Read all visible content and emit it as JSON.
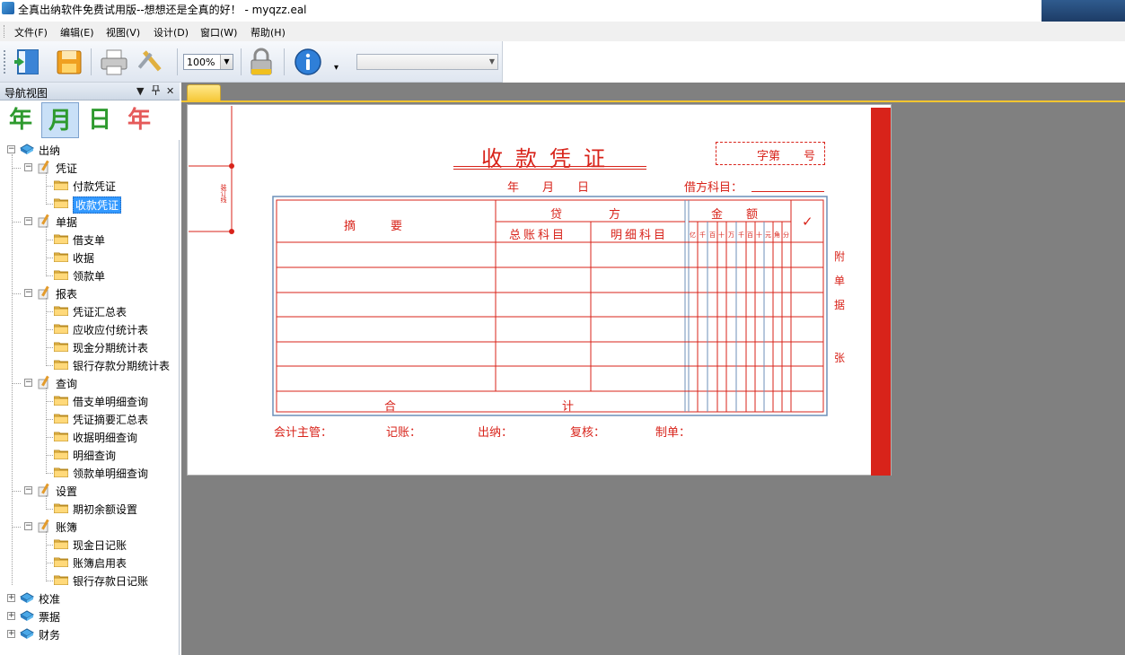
{
  "window": {
    "title": "全真出纳软件免费试用版--想想还是全真的好！ - myqzz.eal"
  },
  "menu": {
    "items": [
      "文件(F)",
      "编辑(E)",
      "视图(V)",
      "设计(D)",
      "窗口(W)",
      "帮助(H)"
    ]
  },
  "toolbar": {
    "zoom_value": "100%",
    "buttons": [
      "exit-icon",
      "save-icon",
      "print-icon",
      "tools-icon",
      "lock-icon",
      "info-icon"
    ]
  },
  "nav": {
    "title": "导航视图",
    "header_buttons": [
      "▼",
      "ᵖ",
      "✕"
    ],
    "date_tabs": [
      {
        "label": "年",
        "color": "#2e9a2e"
      },
      {
        "label": "月",
        "color": "#2e9a2e"
      },
      {
        "label": "日",
        "color": "#2e9a2e"
      },
      {
        "label": "年",
        "color": "#e55a5a"
      }
    ],
    "tree": {
      "root": "出纳",
      "groups": [
        {
          "label": "凭证",
          "items": [
            "付款凭证",
            "收款凭证"
          ]
        },
        {
          "label": "单据",
          "items": [
            "借支单",
            "收据",
            "领款单"
          ]
        },
        {
          "label": "报表",
          "items": [
            "凭证汇总表",
            "应收应付统计表",
            "现金分期统计表",
            "银行存款分期统计表"
          ]
        },
        {
          "label": "查询",
          "items": [
            "借支单明细查询",
            "凭证摘要汇总表",
            "收据明细查询",
            "明细查询",
            "领款单明细查询"
          ]
        },
        {
          "label": "设置",
          "items": [
            "期初余额设置"
          ]
        },
        {
          "label": "账簿",
          "items": [
            "现金日记账",
            "账簿启用表",
            "银行存款日记账"
          ]
        }
      ],
      "collapsed_roots": [
        "校准",
        "票据",
        "财务"
      ],
      "selected": "收款凭证"
    }
  },
  "voucher": {
    "title": "收款凭证",
    "number_box": "字第　　号",
    "date_label": "年　　月　　日",
    "debit_label": "借方科目：",
    "binding_label": "装订线",
    "col_summary": "摘　　　要",
    "col_credit": "贷　　　　方",
    "col_general": "总账科目",
    "col_detail": "明细科目",
    "col_amount": "金　　额",
    "check_mark": "✓",
    "digit_heads": [
      "亿",
      "千",
      "百",
      "十",
      "万",
      "千",
      "百",
      "十",
      "元",
      "角",
      "分"
    ],
    "total_left": "合",
    "total_right": "计",
    "side_label": [
      "附",
      "单",
      "据",
      "张"
    ],
    "footer": [
      "会计主管：",
      "记账：",
      "出纳：",
      "复核：",
      "制单："
    ],
    "accent_color": "#d8231a",
    "frame_color": "#6d8fb8"
  }
}
